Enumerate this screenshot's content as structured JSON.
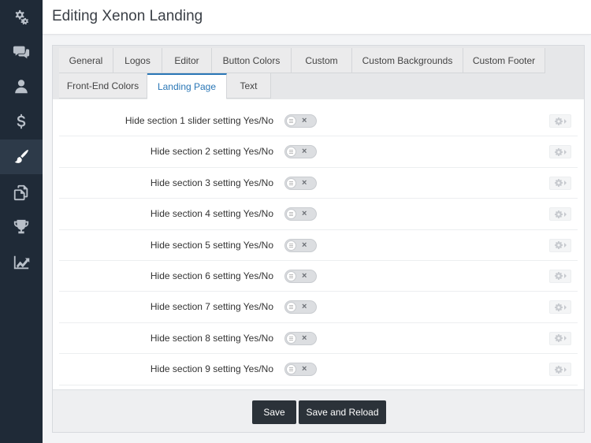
{
  "header": {
    "title": "Editing Xenon Landing"
  },
  "sidebar": {
    "items": [
      {
        "icon": "cogs-icon",
        "active": false
      },
      {
        "icon": "chat-icon",
        "active": false
      },
      {
        "icon": "user-icon",
        "active": false
      },
      {
        "icon": "dollar-icon",
        "active": false
      },
      {
        "icon": "paintbrush-icon",
        "active": true
      },
      {
        "icon": "copy-icon",
        "active": false
      },
      {
        "icon": "trophy-icon",
        "active": false
      },
      {
        "icon": "chart-line-icon",
        "active": false
      }
    ]
  },
  "tabs": [
    {
      "label": "General",
      "active": false
    },
    {
      "label": "Logos",
      "active": false
    },
    {
      "label": "Editor",
      "active": false
    },
    {
      "label": "Button Colors",
      "active": false
    },
    {
      "label": "Custom",
      "active": false
    },
    {
      "label": "Custom Backgrounds",
      "active": false
    },
    {
      "label": "Custom Footer",
      "active": false
    },
    {
      "label": "Front-End Colors",
      "active": false
    },
    {
      "label": "Landing Page",
      "active": true
    },
    {
      "label": "Text",
      "active": false
    }
  ],
  "settings": [
    {
      "label": "Hide section 1 slider setting Yes/No",
      "value": false
    },
    {
      "label": "Hide section 2 setting Yes/No",
      "value": false
    },
    {
      "label": "Hide section 3 setting Yes/No",
      "value": false
    },
    {
      "label": "Hide section 4 setting Yes/No",
      "value": false
    },
    {
      "label": "Hide section 5 setting Yes/No",
      "value": false
    },
    {
      "label": "Hide section 6 setting Yes/No",
      "value": false
    },
    {
      "label": "Hide section 7 setting Yes/No",
      "value": false
    },
    {
      "label": "Hide section 8 setting Yes/No",
      "value": false
    },
    {
      "label": "Hide section 9 setting Yes/No",
      "value": false
    }
  ],
  "toggle": {
    "off_symbol": "×"
  },
  "buttons": {
    "save": "Save",
    "save_reload": "Save and Reload"
  },
  "colors": {
    "sidebar_bg": "#1f2a37",
    "active_tab": "#2a77b6",
    "button_bg": "#2b3239"
  }
}
